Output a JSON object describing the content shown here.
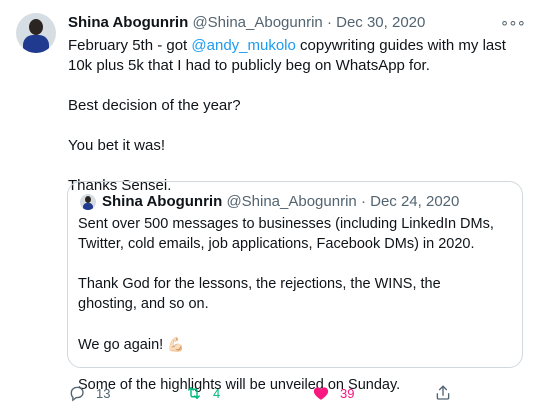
{
  "tweet": {
    "author_name": "Shina Abogunrin",
    "author_handle": "@Shina_Abogunrin",
    "separator": "·",
    "date": "Dec 30, 2020",
    "more": "∘∘∘",
    "text": {
      "line1_prefix": "February 5th - got ",
      "mention": "@andy_mukolo",
      "line1_suffix": " copywriting guides with my last 10k plus 5k that I had to publicly beg on WhatsApp for.",
      "line2": "Best decision of the year?",
      "line3": "You bet it was!",
      "line4": "Thanks Sensei."
    }
  },
  "quote": {
    "author_name": "Shina Abogunrin",
    "author_handle": "@Shina_Abogunrin",
    "separator": "·",
    "date": "Dec 24, 2020",
    "para1": "Sent over 500 messages to businesses (including LinkedIn DMs, Twitter, cold emails, job applications, Facebook DMs) in 2020.",
    "para2": "Thank God for the lessons, the rejections, the WINS, the ghosting, and so on.",
    "para3": "We go again! ",
    "emoji": "💪🏻",
    "para4": "Some of the highlights will be unveiled on Sunday."
  },
  "actions": {
    "reply_count": "13",
    "retweet_count": "4",
    "like_count": "39"
  },
  "colors": {
    "accent": "#1d9bf0",
    "retweet": "#00ba7c",
    "like": "#f91880",
    "secondary_text": "#536471"
  },
  "icons": {
    "reply": "reply-icon",
    "retweet": "retweet-icon",
    "like": "heart-icon",
    "share": "share-icon",
    "more": "more-icon"
  }
}
